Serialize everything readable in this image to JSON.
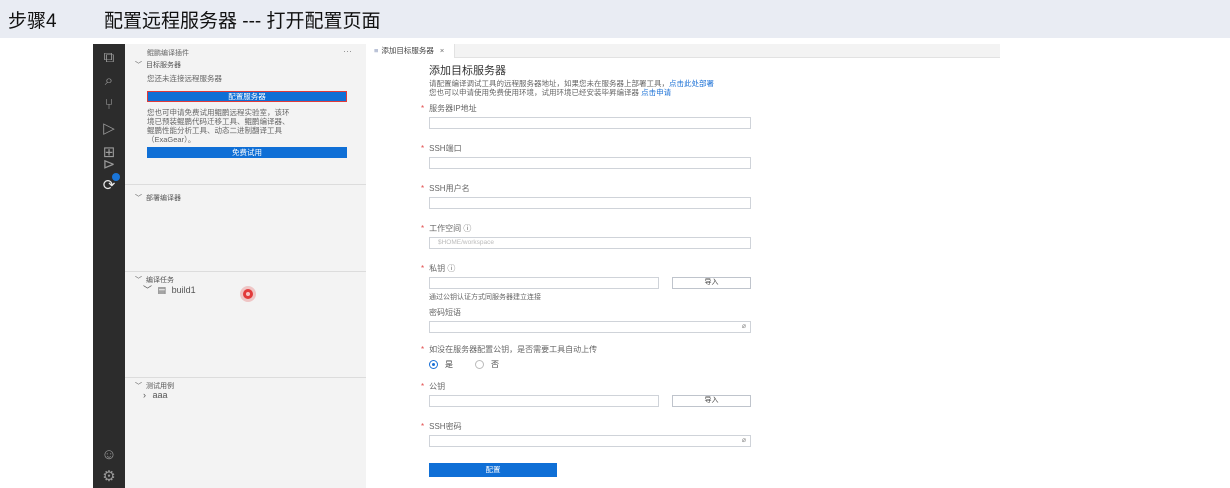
{
  "step": {
    "number": "步骤4",
    "title": "配置远程服务器 --- 打开配置页面"
  },
  "activity_icons": [
    "explorer-icon",
    "search-icon",
    "source-control-icon",
    "run-debug-icon",
    "extensions-icon",
    "play-circle-icon",
    "compile-tool-icon",
    "account-icon",
    "settings-gear-icon"
  ],
  "sidebar": {
    "title": "鲲鹏编译插件",
    "more": "···",
    "target_server": {
      "header": "目标服务器",
      "not_connected": "您还未连接远程服务器",
      "config_button": "配置服务器",
      "trial_text": [
        "您也可申请免费试用鲲鹏远程实验室，该环",
        "境已预装鲲鹏代码迁移工具、鲲鹏编译器、",
        "鲲鹏性能分析工具、动态二进制翻译工具",
        "（ExaGear）。"
      ],
      "trial_button": "免费试用"
    },
    "deploy_compiler": {
      "header": "部署编译器"
    },
    "compile_tasks": {
      "header": "编译任务",
      "items": [
        "build1"
      ]
    },
    "test_cases": {
      "header": "测试用例",
      "items": [
        "aaa"
      ]
    }
  },
  "tab": {
    "label": "添加目标服务器",
    "close": "×"
  },
  "form": {
    "title": "添加目标服务器",
    "desc1": "请配置编译调试工具的远程服务器地址，如果您未在服务器上部署工具，",
    "desc1_link": "点击此处部署",
    "desc2": "您也可以申请使用免费使用环境，试用环境已经安装毕昇编译器",
    "desc2_link": "点击申请",
    "required_mark": "*",
    "ip_label": "服务器IP地址",
    "ssh_port_label": "SSH端口",
    "ssh_user_label": "SSH用户名",
    "workspace_label": "工作空间 ⓘ",
    "workspace_placeholder": "$HOME/workspace",
    "private_key_label": "私钥 ⓘ",
    "import_label": "导入",
    "key_note": "通过公钥认证方式同服务器建立连接",
    "passphrase_label": "密码短语",
    "upload_question": "如没在服务器配置公钥，是否需要工具自动上传",
    "radio_yes": "是",
    "radio_no": "否",
    "public_key_label": "公钥",
    "ssh_password_label": "SSH密码",
    "eye_icon": "⌀",
    "submit": "配置"
  }
}
